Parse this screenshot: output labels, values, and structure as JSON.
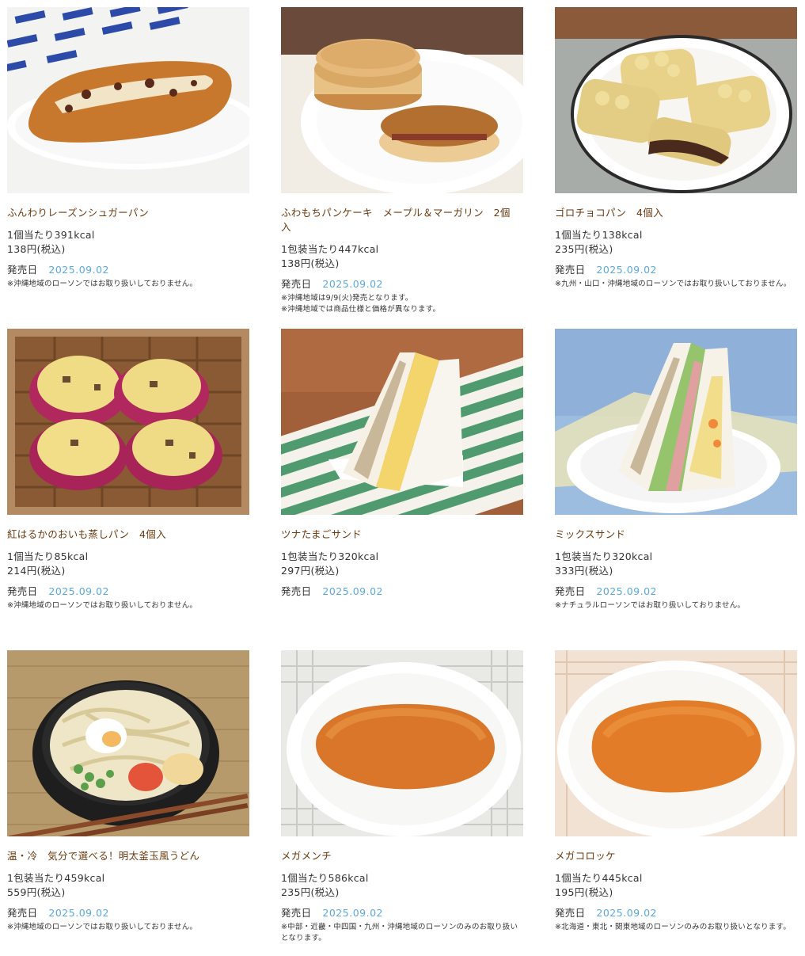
{
  "products": [
    {
      "name": "ふんわりレーズンシュガーパン",
      "kcal": "1個当たり391kcal",
      "price": "138円(税込)",
      "date_label": "発売日",
      "date": "2025.09.02",
      "notes": [
        "※沖縄地域のローソンではお取り扱いしておりません。"
      ],
      "image": "raisin-sugar-bread-photo"
    },
    {
      "name": "ふわもちパンケーキ　メープル＆マーガリン　2個入",
      "kcal": "1包装当たり447kcal",
      "price": "138円(税込)",
      "date_label": "発売日",
      "date": "2025.09.02",
      "notes": [
        "※沖縄地域は9/9(火)発売となります。",
        "※沖縄地域では商品仕様と価格が異なります。"
      ],
      "image": "pancake-photo"
    },
    {
      "name": "ゴロチョコパン　4個入",
      "kcal": "1個当たり138kcal",
      "price": "235円(税込)",
      "date_label": "発売日",
      "date": "2025.09.02",
      "notes": [
        "※九州・山口・沖縄地域のローソンではお取り扱いしておりません。"
      ],
      "image": "choco-bread-photo"
    },
    {
      "name": "紅はるかのおいも蒸しパン　4個入",
      "kcal": "1個当たり85kcal",
      "price": "214円(税込)",
      "date_label": "発売日",
      "date": "2025.09.02",
      "notes": [
        "※沖縄地域のローソンではお取り扱いしておりません。"
      ],
      "image": "sweet-potato-bun-photo"
    },
    {
      "name": "ツナたまごサンド",
      "kcal": "1包装当たり320kcal",
      "price": "297円(税込)",
      "date_label": "発売日",
      "date": "2025.09.02",
      "notes": [],
      "image": "tuna-egg-sandwich-photo"
    },
    {
      "name": "ミックスサンド",
      "kcal": "1包装当たり320kcal",
      "price": "333円(税込)",
      "date_label": "発売日",
      "date": "2025.09.02",
      "notes": [
        "※ナチュラルローソンではお取り扱いしておりません。"
      ],
      "image": "mix-sandwich-photo"
    },
    {
      "name": "温・冷　気分で選べる！明太釜玉風うどん",
      "kcal": "1包装当たり459kcal",
      "price": "559円(税込)",
      "date_label": "発売日",
      "date": "2025.09.02",
      "notes": [
        "※沖縄地域のローソンではお取り扱いしておりません。"
      ],
      "image": "mentai-udon-photo"
    },
    {
      "name": "メガメンチ",
      "kcal": "1個当たり586kcal",
      "price": "235円(税込)",
      "date_label": "発売日",
      "date": "2025.09.02",
      "notes": [
        "※中部・近畿・中四国・九州・沖縄地域のローソンのみのお取り扱いとなります。"
      ],
      "image": "mega-menchi-photo"
    },
    {
      "name": "メガコロッケ",
      "kcal": "1個当たり445kcal",
      "price": "195円(税込)",
      "date_label": "発売日",
      "date": "2025.09.02",
      "notes": [
        "※北海道・東北・関東地域のローソンのみのお取り扱いとなります。"
      ],
      "image": "mega-croquette-photo"
    }
  ],
  "colors": {
    "name": "#6b3a0f",
    "date": "#5aa9dc",
    "text": "#333333"
  }
}
